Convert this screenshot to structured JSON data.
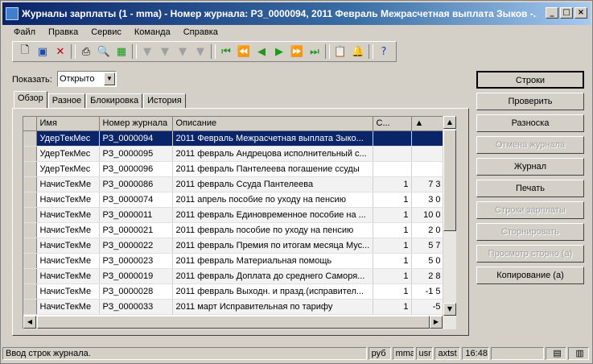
{
  "window": {
    "title": "Журналы зарплаты (1 - mma) - Номер журнала: РЗ_0000094, 2011 Февраль Межрасчетная выплата Зыков -..."
  },
  "titlebar_buttons": [
    "_",
    "□",
    "×"
  ],
  "menu": [
    "Файл",
    "Правка",
    "Сервис",
    "Команда",
    "Справка"
  ],
  "toolbar_icons": [
    "new-icon",
    "save-icon",
    "delete-icon",
    "print-icon",
    "print-preview-icon",
    "excel-icon",
    "filter-icon",
    "filter-by-selection-icon",
    "advanced-filter-icon",
    "remove-filter-icon",
    "first-record-icon",
    "previous-page-icon",
    "previous-record-icon",
    "next-record-icon",
    "next-page-icon",
    "last-record-icon",
    "attachments-icon",
    "alert-icon",
    "help-icon"
  ],
  "filter": {
    "label": "Показать:",
    "value": "Открыто"
  },
  "tabs": [
    "Обзор",
    "Разное",
    "Блокировка",
    "История"
  ],
  "grid": {
    "columns": [
      "Имя",
      "Номер журнала",
      "Описание",
      "С..."
    ],
    "rows": [
      {
        "name": "УдерТекМес",
        "journal": "РЗ_0000094",
        "desc": "2011 Февраль Межрасчетная выплата Зыко...",
        "c": "",
        "amount": ""
      },
      {
        "name": "УдерТекМес",
        "journal": "РЗ_0000095",
        "desc": "2011 февраль Андрецова исполнительный с...",
        "c": "",
        "amount": ""
      },
      {
        "name": "УдерТекМес",
        "journal": "РЗ_0000096",
        "desc": "2011 февраль Пантелеева погашение ссуды",
        "c": "",
        "amount": ""
      },
      {
        "name": "НачисТекМе",
        "journal": "РЗ_0000086",
        "desc": "2011 февраль Ссуда Пантелеева",
        "c": "1",
        "amount": "7 3"
      },
      {
        "name": "НачисТекМе",
        "journal": "РЗ_0000074",
        "desc": "2011 апрель пособие по уходу на пенсию",
        "c": "1",
        "amount": "3 0"
      },
      {
        "name": "НачисТекМе",
        "journal": "РЗ_0000011",
        "desc": "2011 февраль Единовременное пособие на ...",
        "c": "1",
        "amount": "10 0"
      },
      {
        "name": "НачисТекМе",
        "journal": "РЗ_0000021",
        "desc": "2011 февраль пособие по уходу на пенсию",
        "c": "1",
        "amount": "2 0"
      },
      {
        "name": "НачисТекМе",
        "journal": "РЗ_0000022",
        "desc": "2011 февраль Премия по итогам месяца Мус...",
        "c": "1",
        "amount": "5 7"
      },
      {
        "name": "НачисТекМе",
        "journal": "РЗ_0000023",
        "desc": "2011 февраль Материальная помощь",
        "c": "1",
        "amount": "5 0"
      },
      {
        "name": "НачисТекМе",
        "journal": "РЗ_0000019",
        "desc": "2011 февраль Доплата до среднего Саморя...",
        "c": "1",
        "amount": "2 8"
      },
      {
        "name": "НачисТекМе",
        "journal": "РЗ_0000028",
        "desc": "2011 февраль Выходн. и празд.(исправител...",
        "c": "1",
        "amount": "-1 5"
      },
      {
        "name": "НачисТекМе",
        "journal": "РЗ_0000033",
        "desc": "2011 март Исправительная по тарифу",
        "c": "1",
        "amount": "-5"
      }
    ]
  },
  "buttons": [
    {
      "label": "Строки",
      "disabled": false,
      "default": true
    },
    {
      "label": "Проверить",
      "disabled": false
    },
    {
      "label": "Разноска",
      "disabled": false
    },
    {
      "label": "Отмена журнала",
      "disabled": true
    },
    {
      "label": "Журнал",
      "disabled": false
    },
    {
      "label": "Печать",
      "disabled": false
    },
    {
      "label": "Строки зарплаты",
      "disabled": true
    },
    {
      "label": "Сторнировать",
      "disabled": true
    },
    {
      "label": "Просмотр сторно (а)",
      "disabled": true
    },
    {
      "label": "Копирование (а)",
      "disabled": false
    }
  ],
  "status": {
    "message": "Ввод строк журнала.",
    "currency": "руб",
    "company": "mma",
    "layer": "usr",
    "server": "axtst",
    "time": "16:48"
  }
}
